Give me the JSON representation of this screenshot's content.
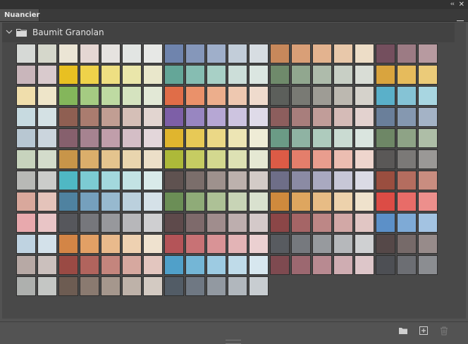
{
  "panel": {
    "tab_label": "Nuancier",
    "collapse_glyph": "‹‹",
    "close_glyph": "✕"
  },
  "group": {
    "name": "Baumit Granolan",
    "expanded": true,
    "icon": "folder-icon"
  },
  "bottom_toolbar": {
    "icons": [
      "new-group-folder-icon",
      "new-swatch-icon",
      "trash-icon"
    ]
  },
  "swatches": [
    [
      "#d6d9d6",
      "#d5d7cb",
      "#ebe5d5",
      "#e5d7d3",
      "#e6e3e0",
      "#e2e5e3",
      "#e7e8e6",
      "#6f84ad",
      "#8597ba",
      "#9fafca",
      "#c2cdd9",
      "#d7dde2",
      "#c7885b",
      "#d99f77",
      "#e3b38f",
      "#e8c8aa",
      "#edddc7",
      "#744f5e",
      "#9c7b84",
      "#b79aa0"
    ],
    [
      "#c9b6bb",
      "#d9cacd",
      "#e8c022",
      "#efd24a",
      "#eedf82",
      "#eae6aa",
      "#e9e7cb",
      "#64a698",
      "#86bdb2",
      "#a8d0c6",
      "#ccded9",
      "#dbe6e1",
      "#6f8a6b",
      "#91a78f",
      "#aebbab",
      "#c8cfc5",
      "#d9ddd6",
      "#d9a43e",
      "#e6bb5c",
      "#ebcb79"
    ],
    [
      "#f0deac",
      "#eee5c9",
      "#84b65b",
      "#a5cb82",
      "#bedaa2",
      "#d5e3bf",
      "#e2e8d6",
      "#e06d48",
      "#ea916a",
      "#ecae8c",
      "#eec8b0",
      "#efdbcd",
      "#5c5f5b",
      "#797a74",
      "#9e9c95",
      "#bcb8b0",
      "#d5d2cb",
      "#5ab0c9",
      "#85c3d5",
      "#a8d6e1"
    ],
    [
      "#c7dae0",
      "#d4e1e4",
      "#8f5f52",
      "#aa7c6f",
      "#c19e93",
      "#d5bfb7",
      "#e2d5d0",
      "#7d5fa7",
      "#9886c1",
      "#b6a7d4",
      "#cdc4e0",
      "#dfdbe9",
      "#8c5e5d",
      "#a87e7c",
      "#c19d99",
      "#d5bbb7",
      "#e3d2cf",
      "#6a7f9a",
      "#8598b0",
      "#a4b3c6"
    ],
    [
      "#b8c7d2",
      "#cbd5dd",
      "#86606d",
      "#a68390",
      "#c09eaa",
      "#d4bec6",
      "#e3d6da",
      "#e0b52e",
      "#e7c956",
      "#ebd886",
      "#ede5b4",
      "#efecd6",
      "#6b9b86",
      "#8fb3a3",
      "#aecbbd",
      "#cadbd2",
      "#dae5df",
      "#6e8766",
      "#8ea386",
      "#aebea7"
    ],
    [
      "#c7d3bd",
      "#d3dccb",
      "#c89549",
      "#dbae6b",
      "#e4c48e",
      "#e9d5ae",
      "#ecdfc8",
      "#adb939",
      "#c6cc62",
      "#d3d88f",
      "#dde1b4",
      "#e5e8d3",
      "#dc5b46",
      "#e47e6b",
      "#e99d8e",
      "#ebbdb1",
      "#eed5cd",
      "#5a5857",
      "#7b7977",
      "#9a9896"
    ],
    [
      "#b8b9b6",
      "#cbccca",
      "#4fb8c4",
      "#7ccbd3",
      "#a3d8dd",
      "#c3e3e4",
      "#d9ebea",
      "#5f5250",
      "#7b6e6b",
      "#9e918d",
      "#bcb1ad",
      "#d3cbc7",
      "#6e6e88",
      "#8b8ba4",
      "#a9a9c0",
      "#c7c7d7",
      "#dbdbe5",
      "#9a4e3f",
      "#b46d5f",
      "#c98d80"
    ],
    [
      "#d9a89c",
      "#e4c3ba",
      "#4f82a0",
      "#75a0bd",
      "#97b9cf",
      "#bbd0dd",
      "#d5e1e8",
      "#6b8e56",
      "#8fab78",
      "#adc196",
      "#c8d4b6",
      "#d9e1cf",
      "#cf8a3d",
      "#dea65f",
      "#e7bc85",
      "#edd2ac",
      "#efe2cc",
      "#dc4c45",
      "#e86c68",
      "#ed8f8c"
    ],
    [
      "#e8a9ad",
      "#e9c5c6",
      "#56575c",
      "#76777c",
      "#97989c",
      "#b7b7ba",
      "#cfcfd1",
      "#5e4a4b",
      "#7e6a6b",
      "#a08d8d",
      "#bdaeae",
      "#d4c9c9",
      "#8b4647",
      "#a56566",
      "#bd8786",
      "#d2a8a6",
      "#e1c6c4",
      "#5c90c8",
      "#7eaad6",
      "#a3c3e2"
    ],
    [
      "#bfd3e1",
      "#d3e1ea",
      "#d38546",
      "#e2a065",
      "#e9ba8c",
      "#eed1b1",
      "#efe2cf",
      "#b45458",
      "#c87275",
      "#d99396",
      "#e3b4b6",
      "#ebd0d1",
      "#585b60",
      "#76797e",
      "#979a9e",
      "#b6b8bb",
      "#cfd0d2",
      "#554848",
      "#766a69",
      "#978b8a"
    ],
    [
      "#b7a9a5",
      "#cbc0bd",
      "#9a4a44",
      "#b1645d",
      "#c4857d",
      "#d6a89f",
      "#e3c6bf",
      "#50a0c9",
      "#74b6d6",
      "#9dcbe2",
      "#bfdbe9",
      "#d7e7ef",
      "#7e4a50",
      "#9c6870",
      "#b88a91",
      "#cfadb2",
      "#ddc6c9",
      "#4d4f54",
      "#6c6e73",
      "#8b8d91"
    ],
    [
      "#aeb0ae",
      "#c4c6c4",
      "#6d5c52",
      "#8a7a70",
      "#a5978d",
      "#beb2a9",
      "#d3cac2",
      "#525c66",
      "#6f7883",
      "#9299a1",
      "#b1b7bd",
      "#c8cdd1"
    ]
  ]
}
